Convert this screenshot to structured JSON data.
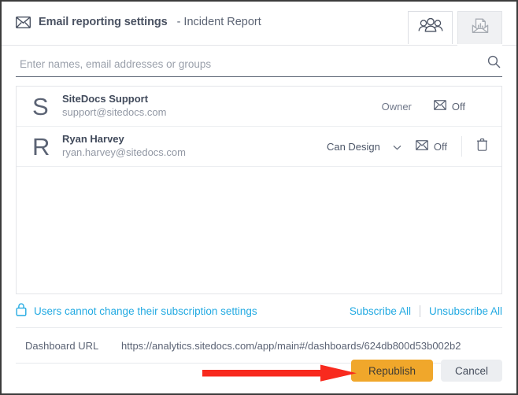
{
  "dialog": {
    "icon": "mail-icon",
    "title": "Email reporting settings",
    "subtitle": "- Incident Report"
  },
  "tabs": [
    {
      "id": "recipients",
      "icon": "people-group-icon",
      "active": true
    },
    {
      "id": "report",
      "icon": "envelope-report-icon",
      "active": false
    }
  ],
  "search": {
    "placeholder": "Enter names, email addresses or groups",
    "value": "",
    "icon": "search-icon"
  },
  "recipients": [
    {
      "initial": "S",
      "name": "SiteDocs Support",
      "email": "support@sitedocs.com",
      "role": "Owner",
      "role_editable": false,
      "subscription": "Off",
      "subscription_icon": "envelope-icon",
      "removable": false
    },
    {
      "initial": "R",
      "name": "Ryan Harvey",
      "email": "ryan.harvey@sitedocs.com",
      "role": "Can Design",
      "role_editable": true,
      "subscription": "Off",
      "subscription_icon": "envelope-icon",
      "removable": true,
      "remove_icon": "trash-icon"
    }
  ],
  "subscription_bar": {
    "lock_icon": "lock-icon",
    "note": "Users cannot change their subscription settings",
    "subscribe_all": "Subscribe All",
    "unsubscribe_all": "Unsubscribe All"
  },
  "dashboard_url": {
    "label": "Dashboard URL",
    "value": "https://analytics.sitedocs.com/app/main#/dashboards/624db800d53b002b2"
  },
  "footer": {
    "primary_label": "Republish",
    "secondary_label": "Cancel"
  },
  "annotation": {
    "type": "arrow",
    "points_to": "Republish",
    "color": "#f82a1e"
  },
  "colors": {
    "accent_link": "#23aae2",
    "primary_button": "#f0a72b",
    "secondary_button": "#eceef1",
    "text": "#4a5262",
    "muted_text": "#9298a4",
    "annotation_red": "#f82a1e",
    "window_border": "#3b3b3b"
  }
}
